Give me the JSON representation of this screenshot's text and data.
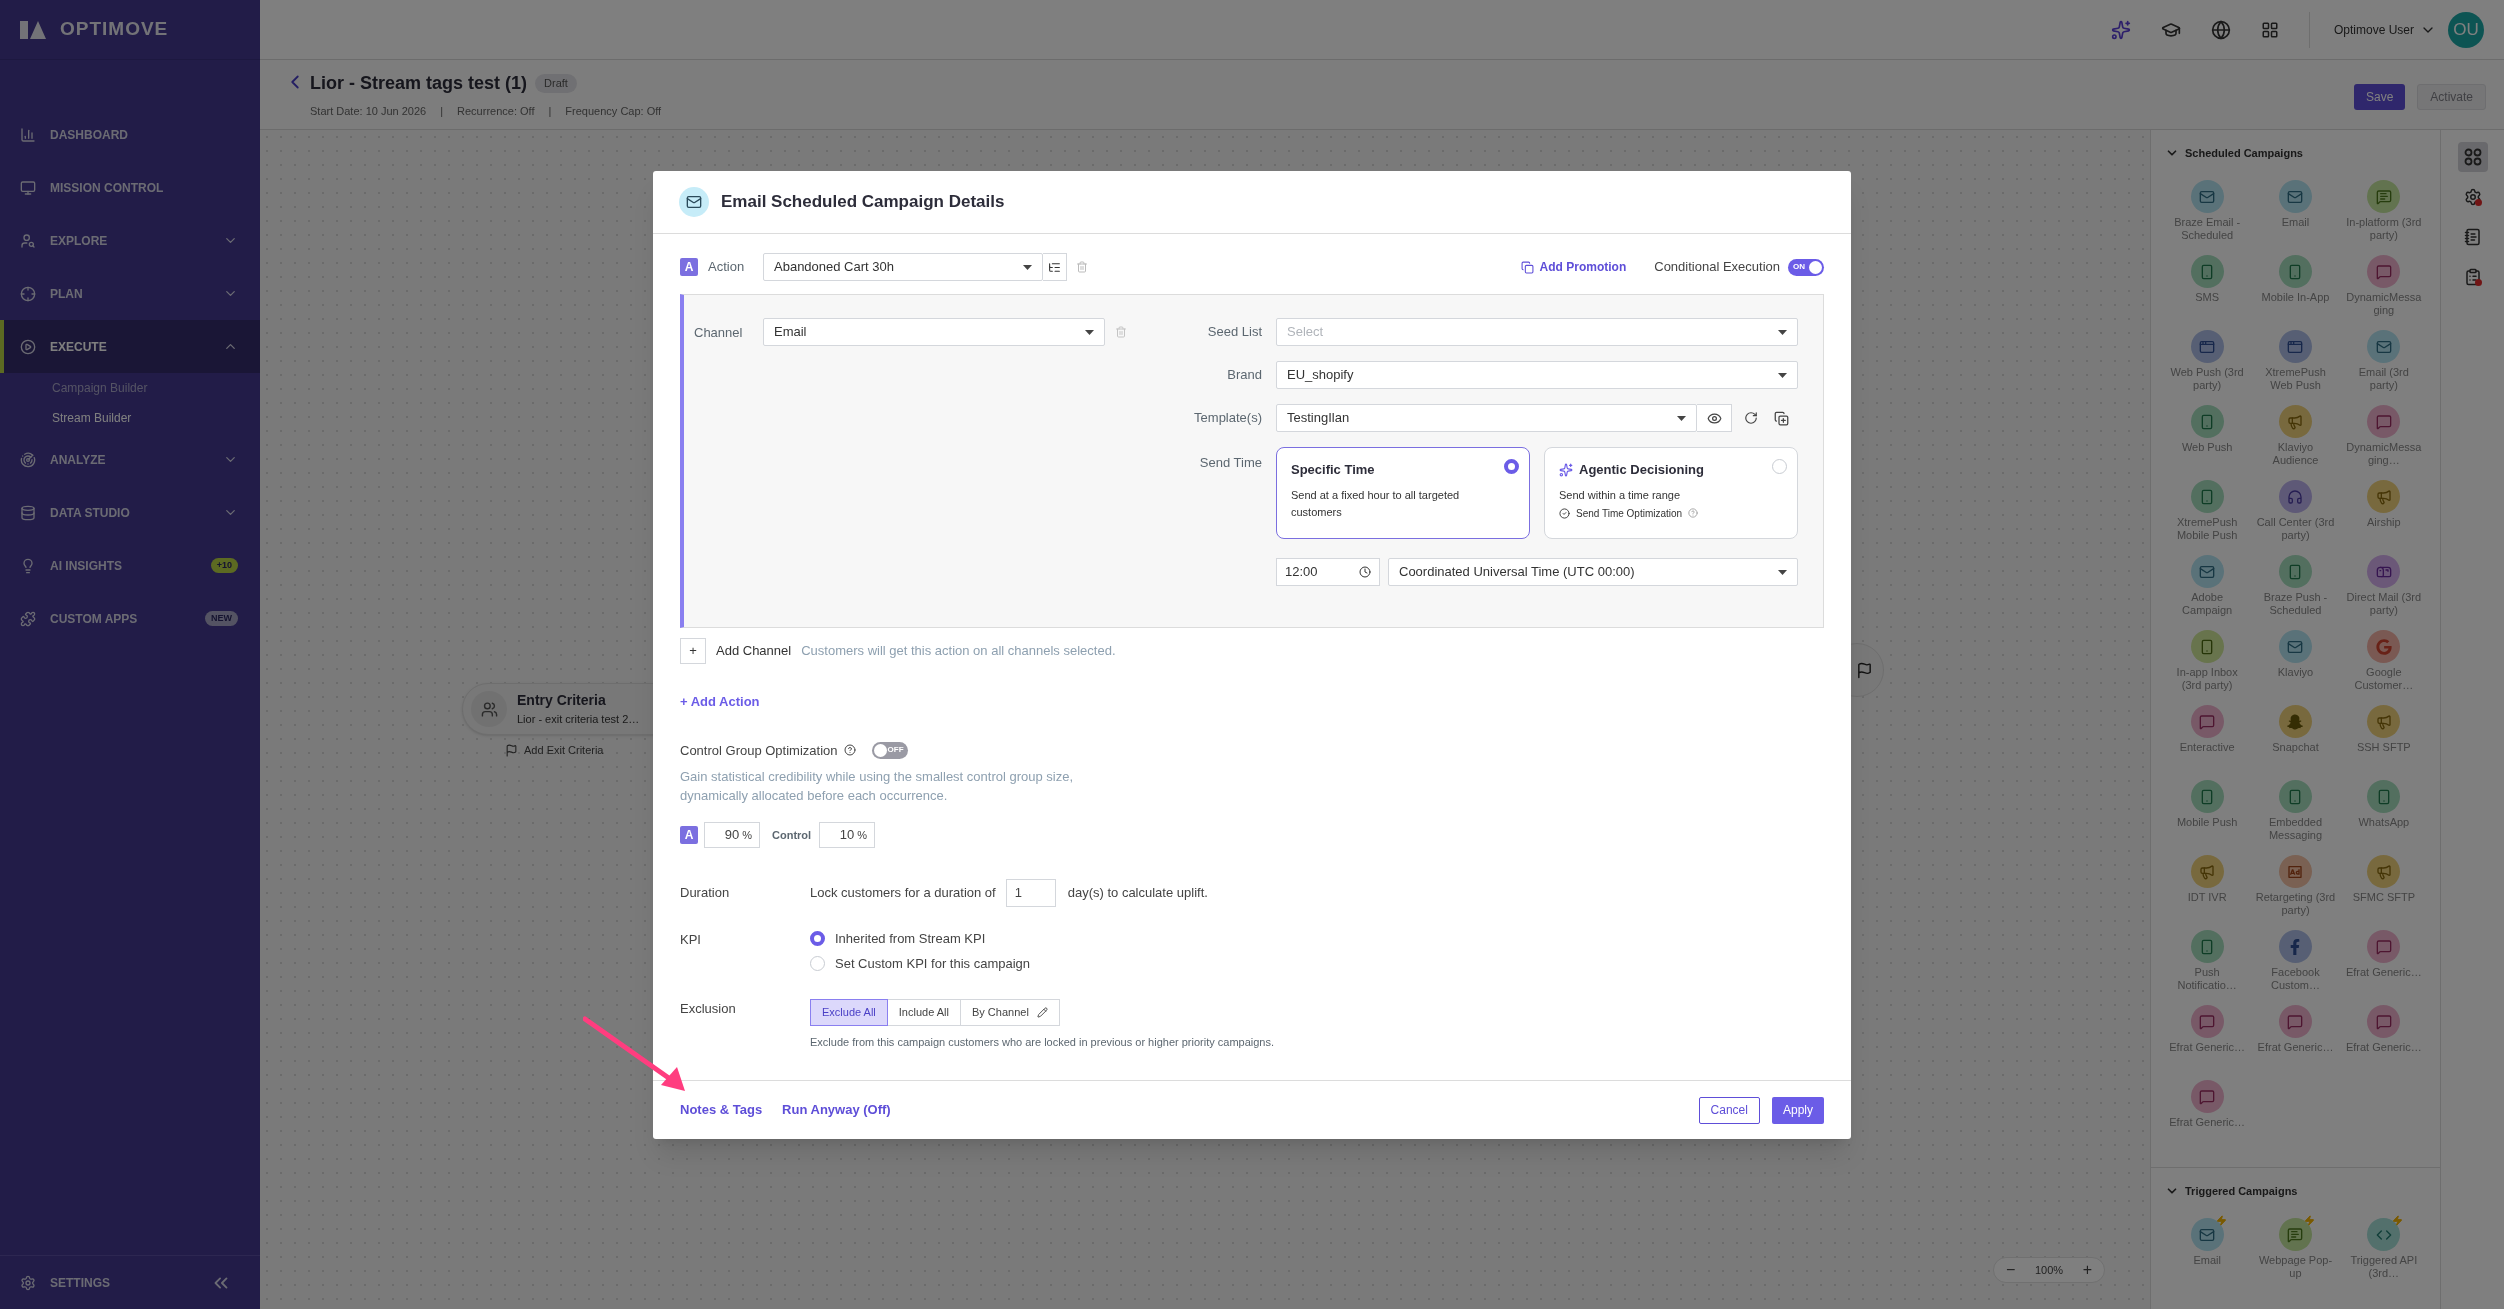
{
  "sidebar": {
    "logo": "OPTIMOVE",
    "items": [
      {
        "label": "DASHBOARD",
        "selected": false
      },
      {
        "label": "MISSION CONTROL",
        "selected": false
      },
      {
        "label": "EXPLORE",
        "selected": false,
        "expanded": false
      },
      {
        "label": "PLAN",
        "selected": false,
        "expanded": false
      },
      {
        "label": "EXECUTE",
        "selected": true,
        "expanded": true,
        "children": [
          {
            "label": "Campaign Builder",
            "selected": false
          },
          {
            "label": "Stream Builder",
            "selected": true
          }
        ]
      },
      {
        "label": "ANALYZE",
        "selected": false,
        "expanded": false
      },
      {
        "label": "DATA STUDIO",
        "selected": false,
        "expanded": false
      },
      {
        "label": "AI INSIGHTS",
        "selected": false,
        "badge": "+10",
        "kind": "count"
      },
      {
        "label": "CUSTOM APPS",
        "selected": false,
        "badge": "NEW",
        "kind": "new"
      }
    ],
    "settings": "SETTINGS"
  },
  "topbar": {
    "user": "Optimove User",
    "avatar": "OU"
  },
  "campaign": {
    "title": "Lior - Stream tags test (1)",
    "status": "Draft",
    "meta": [
      "Start Date: 10 Jun 2026",
      "|",
      "Recurrence: Off",
      "|",
      "Frequency Cap: Off"
    ],
    "actions": [
      {
        "label": "Save",
        "disabled": false
      },
      {
        "label": "Activate",
        "disabled": true
      }
    ]
  },
  "canvas": {
    "entry_node": {
      "title": "Entry Criteria",
      "subtitle": "Lior - exit criteria test 2…"
    },
    "add_exit": "Add Exit Criteria",
    "zoom": {
      "out": "−",
      "level": "100%",
      "in": "+"
    }
  },
  "palette": {
    "sections": [
      {
        "title": "Scheduled Campaigns",
        "expanded": true,
        "kind": "scheduled",
        "items": [
          {
            "label": "Braze Email - Scheduled",
            "kind": "mail"
          },
          {
            "label": "Email",
            "kind": "mail"
          },
          {
            "label": "In-platform (3rd party)",
            "kind": "popup"
          },
          {
            "label": "SMS",
            "kind": "phone"
          },
          {
            "label": "Mobile In-App",
            "kind": "phone"
          },
          {
            "label": "DynamicMessaging",
            "kind": "chat"
          },
          {
            "label": "Web Push (3rd party)",
            "kind": "webpush"
          },
          {
            "label": "XtremePush Web Push",
            "kind": "webpush"
          },
          {
            "label": "Email (3rd party)",
            "kind": "mail"
          },
          {
            "label": "Web Push",
            "kind": "phone"
          },
          {
            "label": "Klaviyo Audience",
            "kind": "megaphone"
          },
          {
            "label": "DynamicMessaging…",
            "kind": "chat"
          },
          {
            "label": "XtremePush Mobile Push",
            "kind": "phone"
          },
          {
            "label": "Call Center (3rd party)",
            "kind": "headset"
          },
          {
            "label": "Airship",
            "kind": "megaphone"
          },
          {
            "label": "Adobe Campaign",
            "kind": "mail"
          },
          {
            "label": "Braze Push - Scheduled",
            "kind": "phone"
          },
          {
            "label": "Direct Mail (3rd party)",
            "kind": "mailbox"
          },
          {
            "label": "In-app Inbox (3rd party)",
            "kind": "inbox"
          },
          {
            "label": "Klaviyo",
            "kind": "mail"
          },
          {
            "label": "Google Customer…",
            "kind": "google"
          },
          {
            "label": "Enteractive",
            "kind": "chat"
          },
          {
            "label": "Snapchat",
            "kind": "snapchat"
          },
          {
            "label": "SSH SFTP",
            "kind": "megaphone"
          },
          {
            "label": "Mobile Push",
            "kind": "phone"
          },
          {
            "label": "Embedded Messaging",
            "kind": "phone"
          },
          {
            "label": "WhatsApp",
            "kind": "phone"
          },
          {
            "label": "IDT IVR",
            "kind": "megaphone"
          },
          {
            "label": "Retargeting (3rd party)",
            "kind": "ad"
          },
          {
            "label": "SFMC SFTP",
            "kind": "megaphone"
          },
          {
            "label": "Push Notificatio…",
            "kind": "phone"
          },
          {
            "label": "Facebook Custom…",
            "kind": "facebook"
          },
          {
            "label": "Efrat Generic…",
            "kind": "chat"
          },
          {
            "label": "Efrat Generic…",
            "kind": "chat"
          },
          {
            "label": "Efrat Generic…",
            "kind": "chat"
          },
          {
            "label": "Efrat Generic…",
            "kind": "chat"
          },
          {
            "label": "Efrat Generic…",
            "kind": "chat"
          }
        ]
      },
      {
        "title": "Triggered Campaigns",
        "expanded": true,
        "kind": "triggered",
        "items": [
          {
            "label": "Email",
            "kind": "mail"
          },
          {
            "label": "Webpage Pop-up",
            "kind": "popup"
          },
          {
            "label": "Triggered API (3rd…",
            "kind": "api"
          }
        ]
      }
    ]
  },
  "tool_rail": [
    {
      "selected": true,
      "alert": false
    },
    {
      "selected": false,
      "alert": true
    },
    {
      "selected": false,
      "alert": false
    },
    {
      "selected": false,
      "alert": true
    }
  ],
  "modal": {
    "title": "Email Scheduled Campaign Details",
    "action": {
      "badge": "A",
      "label": "Action",
      "value": "Abandoned Cart 30h"
    },
    "add_promotion": "Add Promotion",
    "conditional_execution": {
      "label": "Conditional Execution",
      "on": true,
      "on_text": "ON"
    },
    "channel": {
      "label": "Channel",
      "value": "Email"
    },
    "fields": [
      {
        "label": "Seed List",
        "placeholder": "Select"
      },
      {
        "label": "Brand",
        "value": "EU_shopify"
      },
      {
        "label": "Template(s)",
        "value": "TestingIlan",
        "kind": "template"
      }
    ],
    "send_time": {
      "label": "Send Time",
      "options": [
        {
          "title": "Specific Time",
          "description": "Send at a fixed hour to all targeted customers",
          "selected": true
        },
        {
          "title": "Agentic Decisioning",
          "description": "Send within a time range",
          "feature": "Send Time Optimization",
          "selected": false
        }
      ],
      "time": "12:00",
      "timezone": "Coordinated Universal Time (UTC 00:00)"
    },
    "add_channel": {
      "button": "+",
      "label": "Add Channel",
      "hint": "Customers will get this action on all channels selected."
    },
    "add_action": "+ Add Action",
    "control_group": {
      "label": "Control Group Optimization",
      "on": false,
      "off_text": "OFF",
      "description": "Gain statistical credibility while using the smallest control group size, dynamically allocated before each occurrence.",
      "variant_badge": "A",
      "variant_value": "90",
      "variant_unit": "%",
      "control_label": "Control",
      "control_value": "10",
      "control_unit": "%"
    },
    "duration": {
      "label": "Duration",
      "before": "Lock customers for a duration of",
      "value": "1",
      "after": "day(s) to calculate uplift."
    },
    "kpi": {
      "label": "KPI",
      "options": [
        {
          "label": "Inherited from Stream KPI",
          "selected": true
        },
        {
          "label": "Set Custom KPI for this campaign",
          "selected": false
        }
      ]
    },
    "exclusion": {
      "label": "Exclusion",
      "options": [
        {
          "label": "Exclude All",
          "selected": true
        },
        {
          "label": "Include All",
          "selected": false
        },
        {
          "label": "By Channel",
          "selected": false,
          "kind": "edit"
        }
      ],
      "note": "Exclude from this campaign customers who are locked in previous or higher priority campaigns."
    },
    "footer_links": [
      "Notes & Tags",
      "Run Anyway (Off)"
    ],
    "cancel": "Cancel",
    "apply": "Apply"
  }
}
